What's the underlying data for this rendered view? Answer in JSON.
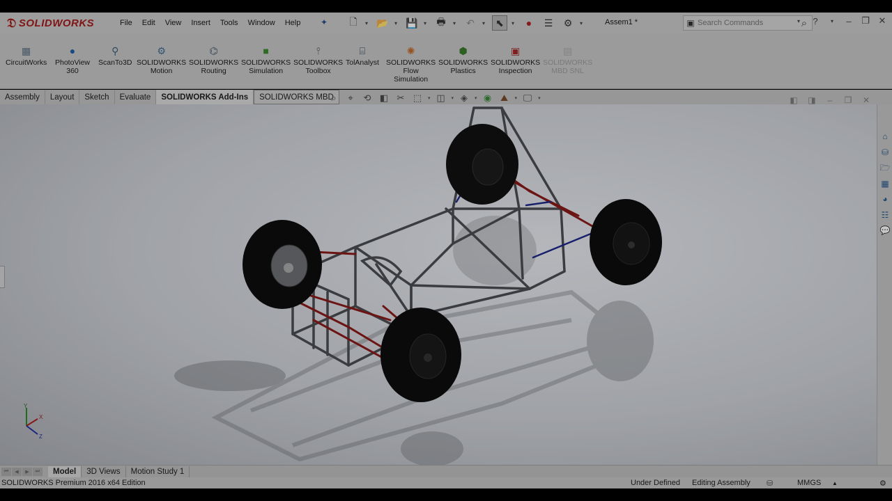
{
  "app": {
    "brand": "SOLIDWORKS",
    "document_title": "Assem1 *"
  },
  "menu": [
    "File",
    "Edit",
    "View",
    "Insert",
    "Tools",
    "Window",
    "Help"
  ],
  "search": {
    "placeholder": "Search Commands"
  },
  "ribbon": [
    {
      "label": "CircuitWorks",
      "icon": "circuitworks-icon",
      "disabled": false
    },
    {
      "label": "PhotoView\n360",
      "icon": "photoview-icon",
      "disabled": false
    },
    {
      "label": "ScanTo3D",
      "icon": "scanto3d-icon",
      "disabled": false
    },
    {
      "label": "SOLIDWORKS\nMotion",
      "icon": "motion-icon",
      "disabled": false
    },
    {
      "label": "SOLIDWORKS\nRouting",
      "icon": "routing-icon",
      "disabled": false
    },
    {
      "label": "SOLIDWORKS\nSimulation",
      "icon": "simulation-icon",
      "disabled": false
    },
    {
      "label": "SOLIDWORKS\nToolbox",
      "icon": "toolbox-icon",
      "disabled": false
    },
    {
      "label": "TolAnalyst",
      "icon": "tolanalyst-icon",
      "disabled": false
    },
    {
      "label": "SOLIDWORKS\nFlow\nSimulation",
      "icon": "flow-simulation-icon",
      "disabled": false
    },
    {
      "label": "SOLIDWORKS\nPlastics",
      "icon": "plastics-icon",
      "disabled": false
    },
    {
      "label": "SOLIDWORKS\nInspection",
      "icon": "inspection-icon",
      "disabled": false
    },
    {
      "label": "SOLIDWORKS\nMBD SNL",
      "icon": "mbd-snl-icon",
      "disabled": true
    }
  ],
  "command_tabs": [
    "Assembly",
    "Layout",
    "Sketch",
    "Evaluate",
    "SOLIDWORKS Add-Ins",
    "SOLIDWORKS MBD"
  ],
  "active_command_tab": "SOLIDWORKS Add-Ins",
  "bottom_tabs": [
    "Model",
    "3D Views",
    "Motion Study 1"
  ],
  "active_bottom_tab": "Model",
  "status": {
    "edition": "SOLIDWORKS Premium 2016 x64 Edition",
    "definition": "Under Defined",
    "mode": "Editing Assembly",
    "units": "MMGS"
  },
  "triad": {
    "x": "X",
    "y": "Y",
    "z": "Z"
  },
  "colors": {
    "brand_red": "#a61c1c",
    "frame": "#5a5a5a",
    "suspension_red": "#8b1a1a",
    "tie_rod_blue": "#1f2a8a"
  }
}
